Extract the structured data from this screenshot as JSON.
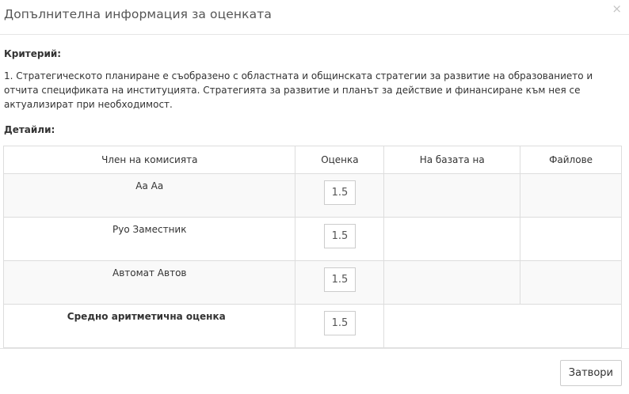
{
  "dialog": {
    "title": "Допълнителна информация за оценката",
    "close_icon": "×"
  },
  "criterion": {
    "label": "Критерий:",
    "text": "1. Стратегическото планиране е съобразено с областната и общинската стратегии за развитие на образованието и отчита спецификата на институцията. Стратегията за развитие и планът за действие и финансиране към нея се актуализират при необходимост."
  },
  "details": {
    "label": "Детайли:",
    "columns": [
      "Член на комисията",
      "Оценка",
      "На базата на",
      "Файлове"
    ],
    "rows": [
      {
        "member": "Аа Аа",
        "score": "1.5",
        "basis": "",
        "files": ""
      },
      {
        "member": "Руо Заместник",
        "score": "1.5",
        "basis": "",
        "files": ""
      },
      {
        "member": "Автомат Автов",
        "score": "1.5",
        "basis": "",
        "files": ""
      }
    ],
    "average": {
      "label": "Средно аритметична оценка",
      "score": "1.5"
    }
  },
  "footer": {
    "close_label": "Затвори"
  }
}
